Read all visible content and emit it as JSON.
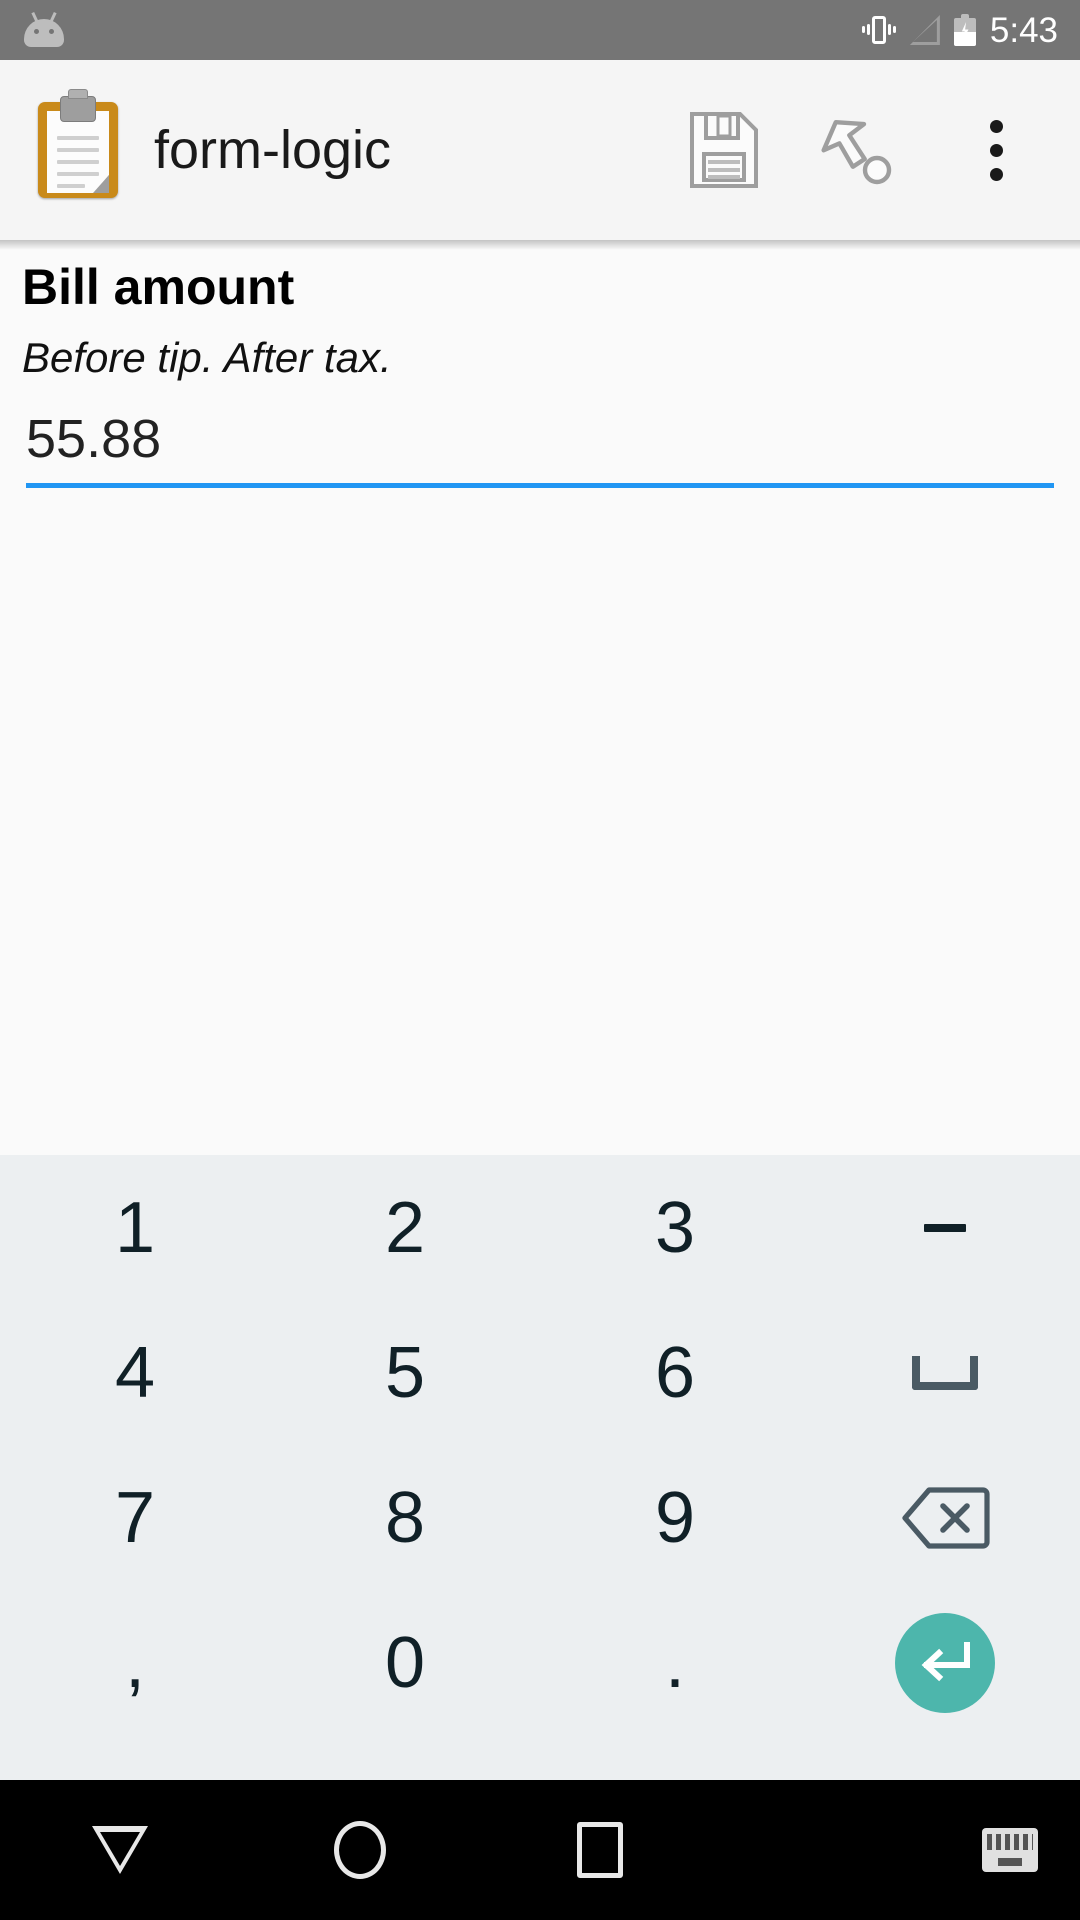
{
  "status_bar": {
    "time": "5:43",
    "icons": [
      "android-head-icon",
      "vibrate-icon",
      "signal-icon",
      "battery-charging-icon"
    ]
  },
  "app_bar": {
    "app_icon": "clipboard-icon",
    "title": "form-logic",
    "actions": [
      {
        "name": "save-icon",
        "label": "Save"
      },
      {
        "name": "goto-icon",
        "label": "Go to"
      },
      {
        "name": "overflow-menu-icon",
        "label": "More options"
      }
    ]
  },
  "form": {
    "question_label": "Bill amount",
    "question_hint": "Before tip. After tax.",
    "input": {
      "value": "55.88",
      "placeholder": "",
      "underline_color": "#2196F3"
    }
  },
  "keyboard": {
    "background": "#ECEFF1",
    "key_color": "#102027",
    "enter_color": "#4DB6AC",
    "rows": [
      [
        {
          "label": "1",
          "name": "key-1",
          "type": "text"
        },
        {
          "label": "2",
          "name": "key-2",
          "type": "text"
        },
        {
          "label": "3",
          "name": "key-3",
          "type": "text"
        },
        {
          "label": "-",
          "name": "key-minus",
          "type": "dash"
        }
      ],
      [
        {
          "label": "4",
          "name": "key-4",
          "type": "text"
        },
        {
          "label": "5",
          "name": "key-5",
          "type": "text"
        },
        {
          "label": "6",
          "name": "key-6",
          "type": "text"
        },
        {
          "label": "",
          "name": "key-space",
          "type": "space"
        }
      ],
      [
        {
          "label": "7",
          "name": "key-7",
          "type": "text"
        },
        {
          "label": "8",
          "name": "key-8",
          "type": "text"
        },
        {
          "label": "9",
          "name": "key-9",
          "type": "text"
        },
        {
          "label": "",
          "name": "key-backspace",
          "type": "backspace"
        }
      ],
      [
        {
          "label": ",",
          "name": "key-comma",
          "type": "text"
        },
        {
          "label": "0",
          "name": "key-0",
          "type": "text"
        },
        {
          "label": ".",
          "name": "key-period",
          "type": "text"
        },
        {
          "label": "",
          "name": "key-enter",
          "type": "enter"
        }
      ]
    ]
  },
  "nav_bar": {
    "buttons": [
      {
        "name": "nav-back-button",
        "label": "Back"
      },
      {
        "name": "nav-home-button",
        "label": "Home"
      },
      {
        "name": "nav-recents-button",
        "label": "Recents"
      },
      {
        "name": "nav-keyboard-switch-button",
        "label": "Switch keyboard"
      }
    ]
  }
}
